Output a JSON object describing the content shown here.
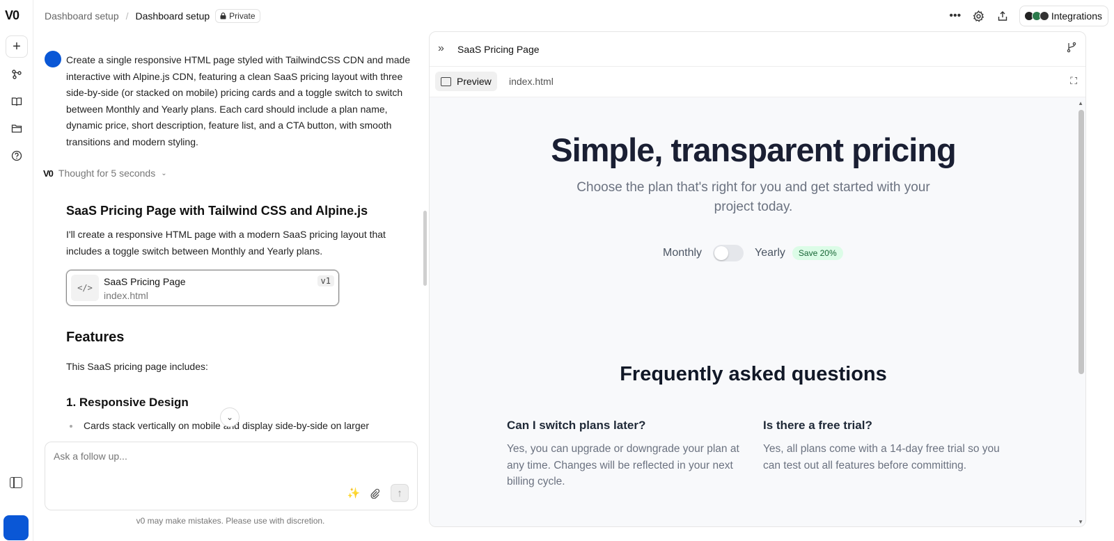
{
  "app": {
    "logo": "V0",
    "breadcrumb_parent": "Dashboard setup",
    "breadcrumb_current": "Dashboard setup",
    "privacy_label": "Private",
    "integrations_label": "Integrations"
  },
  "rail": {
    "icons": [
      "plus-icon",
      "projects-icon",
      "book-icon",
      "folder-icon",
      "help-icon",
      "sidebar-toggle-icon"
    ]
  },
  "chat": {
    "prompt": "Create a single responsive HTML page styled with TailwindCSS CDN and made interactive with Alpine.js CDN, featuring a clean SaaS pricing layout with three side-by-side (or stacked on mobile) pricing cards and a toggle switch to switch between Monthly and Yearly plans. Each card should include a plan name, dynamic price, short description, feature list, and a CTA button, with smooth transitions and modern styling.",
    "thought_label": "Thought for 5 seconds",
    "answer_title": "SaaS Pricing Page with Tailwind CSS and Alpine.js",
    "answer_text": "I'll create a responsive HTML page with a modern SaaS pricing layout that includes a toggle switch between Monthly and Yearly plans.",
    "file_card": {
      "name": "SaaS Pricing Page",
      "path": "index.html",
      "version": "v1"
    },
    "features_title": "Features",
    "features_intro": "This SaaS pricing page includes:",
    "features_h3": "1. Responsive Design",
    "features_item": "Cards stack vertically on mobile and display side-by-side on larger",
    "composer_placeholder": "Ask a follow up...",
    "disclaimer": "v0 may make mistakes. Please use with discretion."
  },
  "preview": {
    "title": "SaaS Pricing Page",
    "tabs": [
      {
        "label": "Preview",
        "active": true
      },
      {
        "label": "index.html",
        "active": false
      }
    ],
    "page": {
      "hero_title": "Simple, transparent pricing",
      "hero_sub": "Choose the plan that's right for you and get started with your project today.",
      "toggle_monthly": "Monthly",
      "toggle_yearly": "Yearly",
      "toggle_yearly_on": false,
      "save_badge": "Save 20%",
      "faq_title": "Frequently asked questions",
      "faqs": [
        {
          "q": "Can I switch plans later?",
          "a": "Yes, you can upgrade or downgrade your plan at any time. Changes will be reflected in your next billing cycle."
        },
        {
          "q": "Is there a free trial?",
          "a": "Yes, all plans come with a 14-day free trial so you can test out all features before committing."
        }
      ]
    }
  },
  "colors": {
    "brand_avatar": "#0a57d6",
    "save_badge_bg": "#dcfce7",
    "save_badge_text": "#166534",
    "preview_bg": "#f8f9fb",
    "hero_title": "#1a1f33"
  }
}
